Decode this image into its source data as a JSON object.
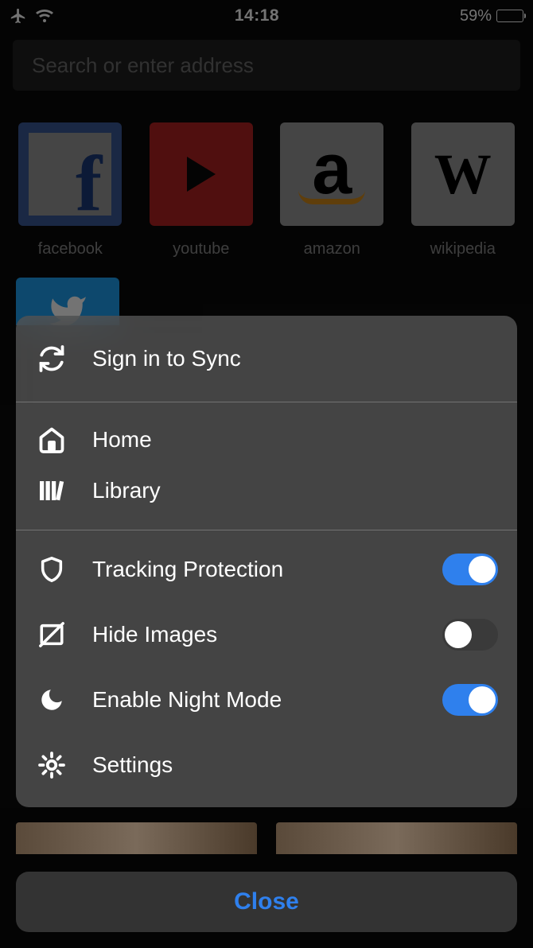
{
  "status": {
    "time": "14:18",
    "battery_pct": "59%"
  },
  "search": {
    "placeholder": "Search or enter address"
  },
  "topsites": [
    {
      "label": "facebook"
    },
    {
      "label": "youtube"
    },
    {
      "label": "amazon"
    },
    {
      "label": "wikipedia"
    }
  ],
  "menu": {
    "sync_label": "Sign in to Sync",
    "home_label": "Home",
    "library_label": "Library",
    "tracking_label": "Tracking Protection",
    "tracking_on": true,
    "hide_images_label": "Hide Images",
    "hide_images_on": false,
    "night_mode_label": "Enable Night Mode",
    "night_mode_on": true,
    "settings_label": "Settings",
    "close_label": "Close"
  }
}
